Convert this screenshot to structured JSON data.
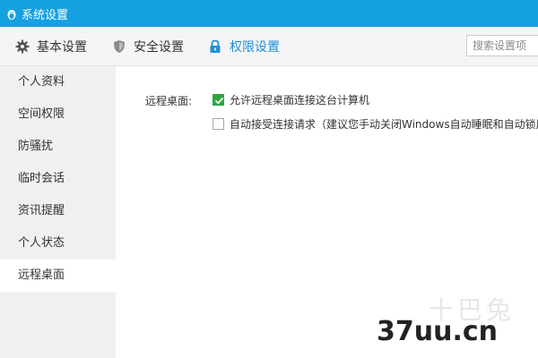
{
  "window": {
    "title": "系统设置",
    "icon": "penguin-icon"
  },
  "toolbar": {
    "tabs": [
      {
        "label": "基本设置",
        "icon": "gear-icon",
        "active": false
      },
      {
        "label": "安全设置",
        "icon": "shield-icon",
        "active": false
      },
      {
        "label": "权限设置",
        "icon": "lock-icon",
        "active": true
      }
    ],
    "search_placeholder": "搜索设置项",
    "active_color": "#1e90d8"
  },
  "sidebar": {
    "items": [
      {
        "label": "个人资料"
      },
      {
        "label": "空间权限"
      },
      {
        "label": "防骚扰"
      },
      {
        "label": "临时会话"
      },
      {
        "label": "资讯提醒"
      },
      {
        "label": "个人状态"
      },
      {
        "label": "远程桌面",
        "active": true
      }
    ]
  },
  "content": {
    "section_label": "远程桌面:",
    "options": [
      {
        "label": "允许远程桌面连接这台计算机",
        "checked": true
      },
      {
        "label": "自动接受连接请求（建议您手动关闭Windows自动睡眠和自动锁屏",
        "checked": false
      }
    ]
  },
  "watermark": {
    "text": "37uu.cn",
    "faint_text": "十巴兔"
  },
  "colors": {
    "titlebar": "#15a0e0",
    "check_green": "#2fa53e"
  }
}
